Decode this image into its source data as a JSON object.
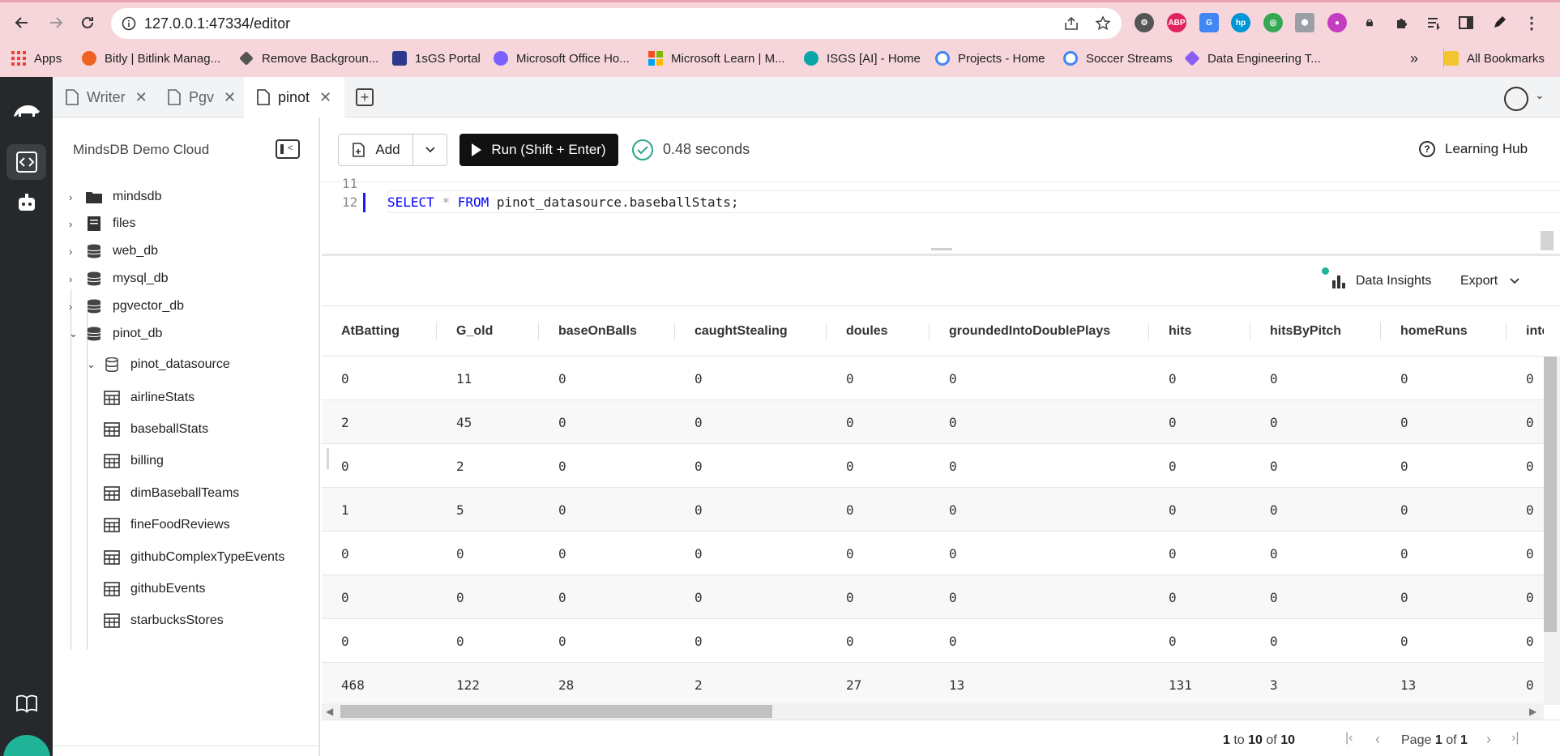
{
  "browser": {
    "url": "127.0.0.1:47334/editor",
    "bookmarks": [
      {
        "label": "Apps",
        "color": "#ea4335"
      },
      {
        "label": "Bitly | Bitlink Manag...",
        "color": "#ee6123"
      },
      {
        "label": "Remove Backgroun...",
        "color": "#555555"
      },
      {
        "label": "1sGS Portal",
        "color": "#2b3a8c"
      },
      {
        "label": "Microsoft Office Ho...",
        "color": "#7b61ff"
      },
      {
        "label": "Microsoft Learn | M...",
        "color": "#f25022"
      },
      {
        "label": "ISGS [AI] - Home",
        "color": "#0aa6a6"
      },
      {
        "label": "Projects - Home",
        "color": "#4285f4"
      },
      {
        "label": "Soccer Streams",
        "color": "#4285f4"
      },
      {
        "label": "Data Engineering T...",
        "color": "#8b5cf6"
      }
    ],
    "more_bookmarks": "»",
    "all_bookmarks": "All Bookmarks",
    "extensions": [
      "ABP",
      "G",
      "hp"
    ]
  },
  "tabs": [
    {
      "label": "Writer",
      "icon": "doc-icon",
      "active": false
    },
    {
      "label": "Pgv",
      "icon": "doc-icon",
      "active": false
    },
    {
      "label": "pinot",
      "icon": "doc-icon",
      "active": true
    }
  ],
  "sidebar": {
    "title": "MindsDB Demo Cloud",
    "tree": [
      {
        "label": "mindsdb",
        "icon": "folder-icon",
        "expanded": false
      },
      {
        "label": "files",
        "icon": "files-icon",
        "expanded": false
      },
      {
        "label": "web_db",
        "icon": "database-icon",
        "expanded": false
      },
      {
        "label": "mysql_db",
        "icon": "database-icon",
        "expanded": false
      },
      {
        "label": "pgvector_db",
        "icon": "database-icon",
        "expanded": false
      },
      {
        "label": "pinot_db",
        "icon": "database-icon",
        "expanded": true
      }
    ],
    "datasource": "pinot_datasource",
    "tables": [
      "airlineStats",
      "baseballStats",
      "billing",
      "dimBaseballTeams",
      "fineFoodReviews",
      "githubComplexTypeEvents",
      "githubEvents",
      "starbucksStores"
    ]
  },
  "toolbar": {
    "add_label": "Add",
    "run_label": "Run (Shift + Enter)",
    "elapsed": "0.48 seconds",
    "learning_hub": "Learning Hub"
  },
  "editor": {
    "prev_line_number": "11",
    "line_number": "12",
    "kw_select": "SELECT",
    "star": "*",
    "kw_from": "FROM",
    "rest": "pinot_datasource.baseballStats;"
  },
  "results": {
    "data_insights": "Data Insights",
    "export": "Export",
    "columns": [
      "AtBatting",
      "G_old",
      "baseOnBalls",
      "caughtStealing",
      "doules",
      "groundedIntoDoublePlays",
      "hits",
      "hitsByPitch",
      "homeRuns",
      "inten"
    ],
    "rows": [
      [
        "0",
        "11",
        "0",
        "0",
        "0",
        "0",
        "0",
        "0",
        "0",
        "0"
      ],
      [
        "2",
        "45",
        "0",
        "0",
        "0",
        "0",
        "0",
        "0",
        "0",
        "0"
      ],
      [
        "0",
        "2",
        "0",
        "0",
        "0",
        "0",
        "0",
        "0",
        "0",
        "0"
      ],
      [
        "1",
        "5",
        "0",
        "0",
        "0",
        "0",
        "0",
        "0",
        "0",
        "0"
      ],
      [
        "0",
        "0",
        "0",
        "0",
        "0",
        "0",
        "0",
        "0",
        "0",
        "0"
      ],
      [
        "0",
        "0",
        "0",
        "0",
        "0",
        "0",
        "0",
        "0",
        "0",
        "0"
      ],
      [
        "0",
        "0",
        "0",
        "0",
        "0",
        "0",
        "0",
        "0",
        "0",
        "0"
      ],
      [
        "468",
        "122",
        "28",
        "2",
        "27",
        "13",
        "131",
        "3",
        "13",
        "0"
      ]
    ],
    "pager": {
      "from": "1",
      "to_word": "to",
      "to": "10",
      "of_word": "of",
      "total": "10",
      "page_word": "Page",
      "page": "1",
      "page_of": "of",
      "pages": "1"
    }
  },
  "colors": {
    "chrome": "#f6d6db",
    "rail": "#26292b",
    "accent": "#1fb497",
    "keyword": "#0000ff"
  }
}
